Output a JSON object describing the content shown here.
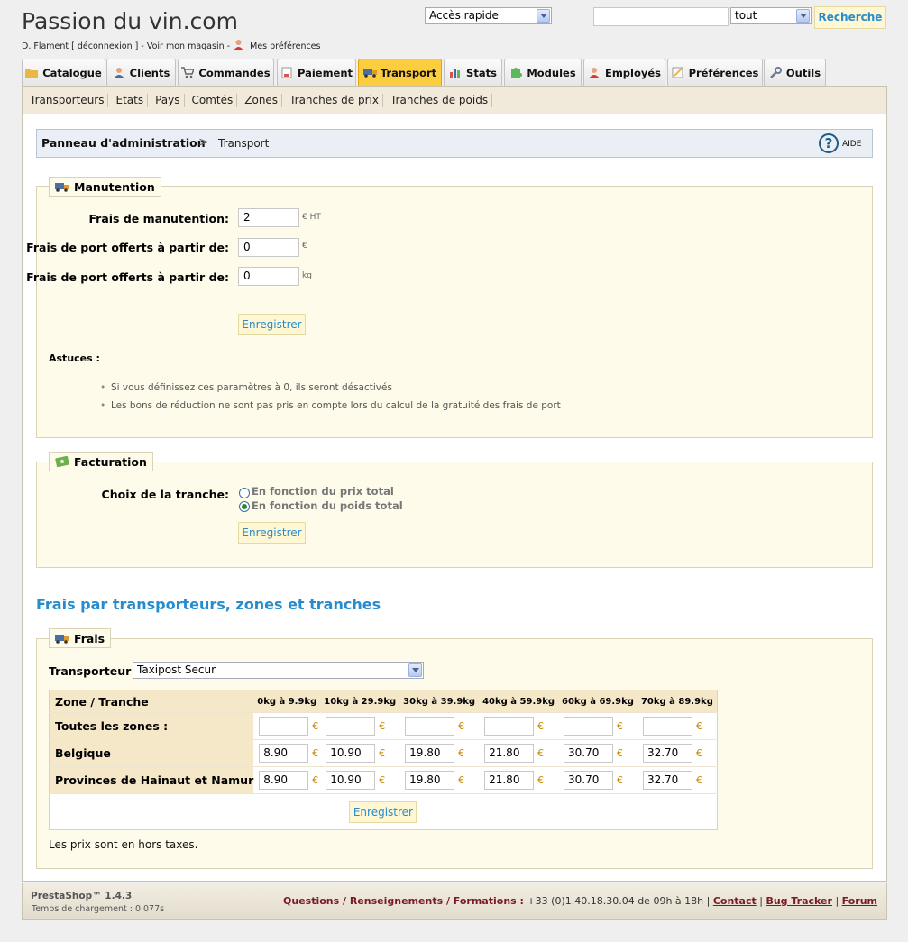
{
  "header": {
    "site_title": "Passion du vin.com",
    "user_name": "D. Flament [",
    "logout_label": "déconnexion",
    "user_suffix": "] - Voir mon magasin -",
    "preferences_label": "Mes préférences",
    "quick_access": "Accès rapide",
    "search_value": "",
    "search_scope": "tout",
    "search_button": "Recherche"
  },
  "tabs": [
    {
      "label": "Catalogue",
      "icon": "folder-icon",
      "active": false
    },
    {
      "label": "Clients",
      "icon": "user-icon",
      "active": false
    },
    {
      "label": "Commandes",
      "icon": "cart-icon",
      "active": false
    },
    {
      "label": "Paiement",
      "icon": "payment-icon",
      "active": false
    },
    {
      "label": "Transport",
      "icon": "truck-icon",
      "active": true
    },
    {
      "label": "Stats",
      "icon": "chart-icon",
      "active": false
    },
    {
      "label": "Modules",
      "icon": "puzzle-icon",
      "active": false
    },
    {
      "label": "Employés",
      "icon": "employee-icon",
      "active": false
    },
    {
      "label": "Préférences",
      "icon": "preferences-icon",
      "active": false
    },
    {
      "label": "Outils",
      "icon": "wrench-icon",
      "active": false
    }
  ],
  "subnav": [
    "Transporteurs",
    "Etats",
    "Pays",
    "Comtés",
    "Zones",
    "Tranches de prix",
    "Tranches de poids"
  ],
  "breadcrumb": {
    "root": "Panneau d'administration",
    "separator": ">",
    "current": "Transport",
    "help": "AIDE"
  },
  "handling": {
    "legend": "Manutention",
    "fields": [
      {
        "label": "Frais de manutention:",
        "value": "2",
        "unit": "€ HT"
      },
      {
        "label": "Frais de port offerts à partir de:",
        "value": "0",
        "unit": "€"
      },
      {
        "label": "Frais de port offerts à partir de:",
        "value": "0",
        "unit": "kg"
      }
    ],
    "save": "Enregistrer",
    "tips_title": "Astuces :",
    "tips": [
      "Si vous définissez ces paramètres à 0, ils seront désactivés",
      "Les bons de réduction ne sont pas pris en compte lors du calcul de la gratuité des frais de port"
    ]
  },
  "billing": {
    "legend": "Facturation",
    "label": "Choix de la tranche:",
    "options": [
      "En fonction du prix total",
      "En fonction du poids total"
    ],
    "selected_index": 1,
    "save": "Enregistrer"
  },
  "fees": {
    "section_title": "Frais par transporteurs, zones et tranches",
    "legend": "Frais",
    "carrier_label": "Transporteur :",
    "carrier_value": "Taxipost Secur",
    "zone_header": "Zone / Tranche",
    "ranges": [
      "0kg à 9.9kg",
      "10kg à 29.9kg",
      "30kg à 39.9kg",
      "40kg à 59.9kg",
      "60kg à 69.9kg",
      "70kg à 89.9kg"
    ],
    "currency": "€",
    "rows": [
      {
        "zone": "Toutes les zones :",
        "values": [
          "",
          "",
          "",
          "",
          "",
          ""
        ]
      },
      {
        "zone": "Belgique",
        "values": [
          "8.90",
          "10.90",
          "19.80",
          "21.80",
          "30.70",
          "32.70"
        ]
      },
      {
        "zone": "Provinces de Hainaut et Namur",
        "values": [
          "8.90",
          "10.90",
          "19.80",
          "21.80",
          "30.70",
          "32.70"
        ]
      }
    ],
    "save": "Enregistrer",
    "note": "Les prix sont en hors taxes."
  },
  "footer": {
    "version": "PrestaShop™ 1.4.3",
    "load_time": "Temps de chargement : 0.077s",
    "support_text": "Questions / Renseignements / Formations :",
    "phone": "+33 (0)1.40.18.30.04",
    "hours": "de 09h à 18h |",
    "links": [
      "Contact",
      "Bug Tracker",
      "Forum"
    ]
  },
  "colors": {
    "accent": "#268ccd",
    "active_tab": "#fccd3e",
    "panel_bg": "#fffbea",
    "footer_link": "#7a1b24"
  }
}
